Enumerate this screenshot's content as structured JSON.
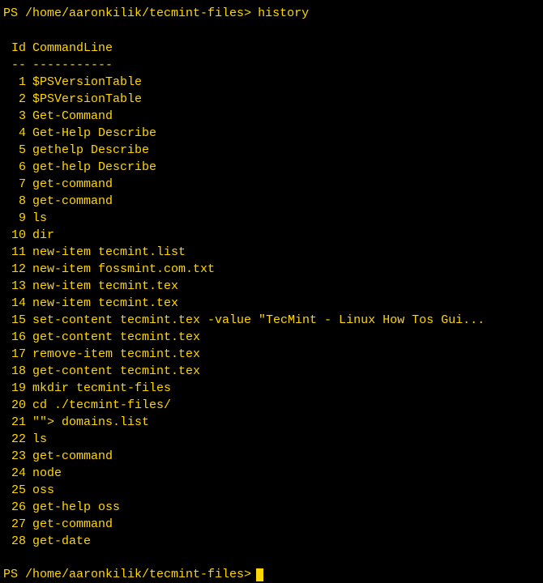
{
  "prompt1": {
    "prefix": "PS /home/aaronkilik/tecmint-files>",
    "command": "history"
  },
  "header": {
    "id": "Id",
    "commandLine": "CommandLine"
  },
  "divider": {
    "id": "--",
    "commandLine": "-----------"
  },
  "history": [
    {
      "id": "1",
      "cmd": "$PSVersionTable"
    },
    {
      "id": "2",
      "cmd": "$PSVersionTable"
    },
    {
      "id": "3",
      "cmd": "Get-Command"
    },
    {
      "id": "4",
      "cmd": "Get-Help Describe"
    },
    {
      "id": "5",
      "cmd": "gethelp Describe"
    },
    {
      "id": "6",
      "cmd": "get-help Describe"
    },
    {
      "id": "7",
      "cmd": "get-command"
    },
    {
      "id": "8",
      "cmd": "get-command"
    },
    {
      "id": "9",
      "cmd": "ls"
    },
    {
      "id": "10",
      "cmd": "dir"
    },
    {
      "id": "11",
      "cmd": "new-item tecmint.list"
    },
    {
      "id": "12",
      "cmd": "new-item fossmint.com.txt"
    },
    {
      "id": "13",
      "cmd": "new-item tecmint.tex"
    },
    {
      "id": "14",
      "cmd": "new-item tecmint.tex"
    },
    {
      "id": "15",
      "cmd": "set-content tecmint.tex -value \"TecMint - Linux How Tos Gui..."
    },
    {
      "id": "16",
      "cmd": "get-content tecmint.tex"
    },
    {
      "id": "17",
      "cmd": "remove-item tecmint.tex"
    },
    {
      "id": "18",
      "cmd": "get-content tecmint.tex"
    },
    {
      "id": "19",
      "cmd": "mkdir tecmint-files"
    },
    {
      "id": "20",
      "cmd": "cd ./tecmint-files/"
    },
    {
      "id": "21",
      "cmd": "\"\"> domains.list"
    },
    {
      "id": "22",
      "cmd": "ls"
    },
    {
      "id": "23",
      "cmd": "get-command"
    },
    {
      "id": "24",
      "cmd": "node"
    },
    {
      "id": "25",
      "cmd": "oss"
    },
    {
      "id": "26",
      "cmd": "get-help oss"
    },
    {
      "id": "27",
      "cmd": "get-command"
    },
    {
      "id": "28",
      "cmd": "get-date"
    }
  ],
  "prompt2": {
    "prefix": "PS /home/aaronkilik/tecmint-files>"
  }
}
